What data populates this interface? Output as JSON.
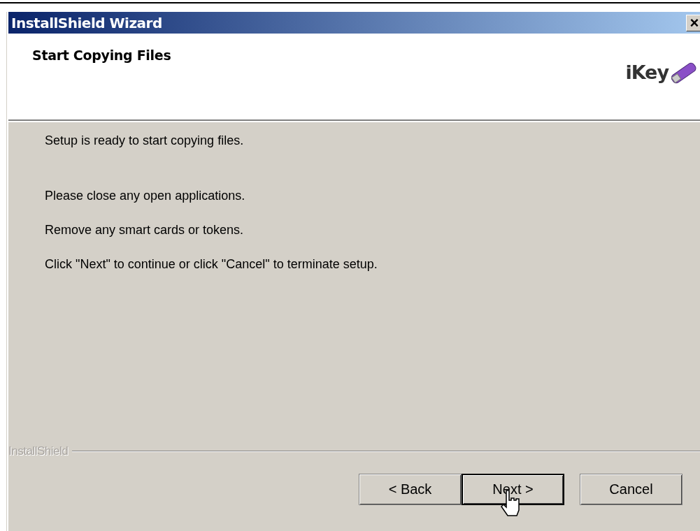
{
  "window": {
    "title": "InstallShield Wizard",
    "close": "×"
  },
  "header": {
    "title": "Start Copying Files",
    "logo": "iKey"
  },
  "body": {
    "paragraphs": [
      "Setup is ready to start copying files.",
      "Please close any open applications.",
      "Remove any smart cards or tokens.",
      "Click \"Next\" to continue or click \"Cancel\" to terminate setup."
    ]
  },
  "footer": {
    "brand": "InstallShield"
  },
  "buttons": [
    {
      "label": "< Back",
      "default": false
    },
    {
      "label": "Next >",
      "default": true
    },
    {
      "label": "Cancel",
      "default": false
    }
  ]
}
